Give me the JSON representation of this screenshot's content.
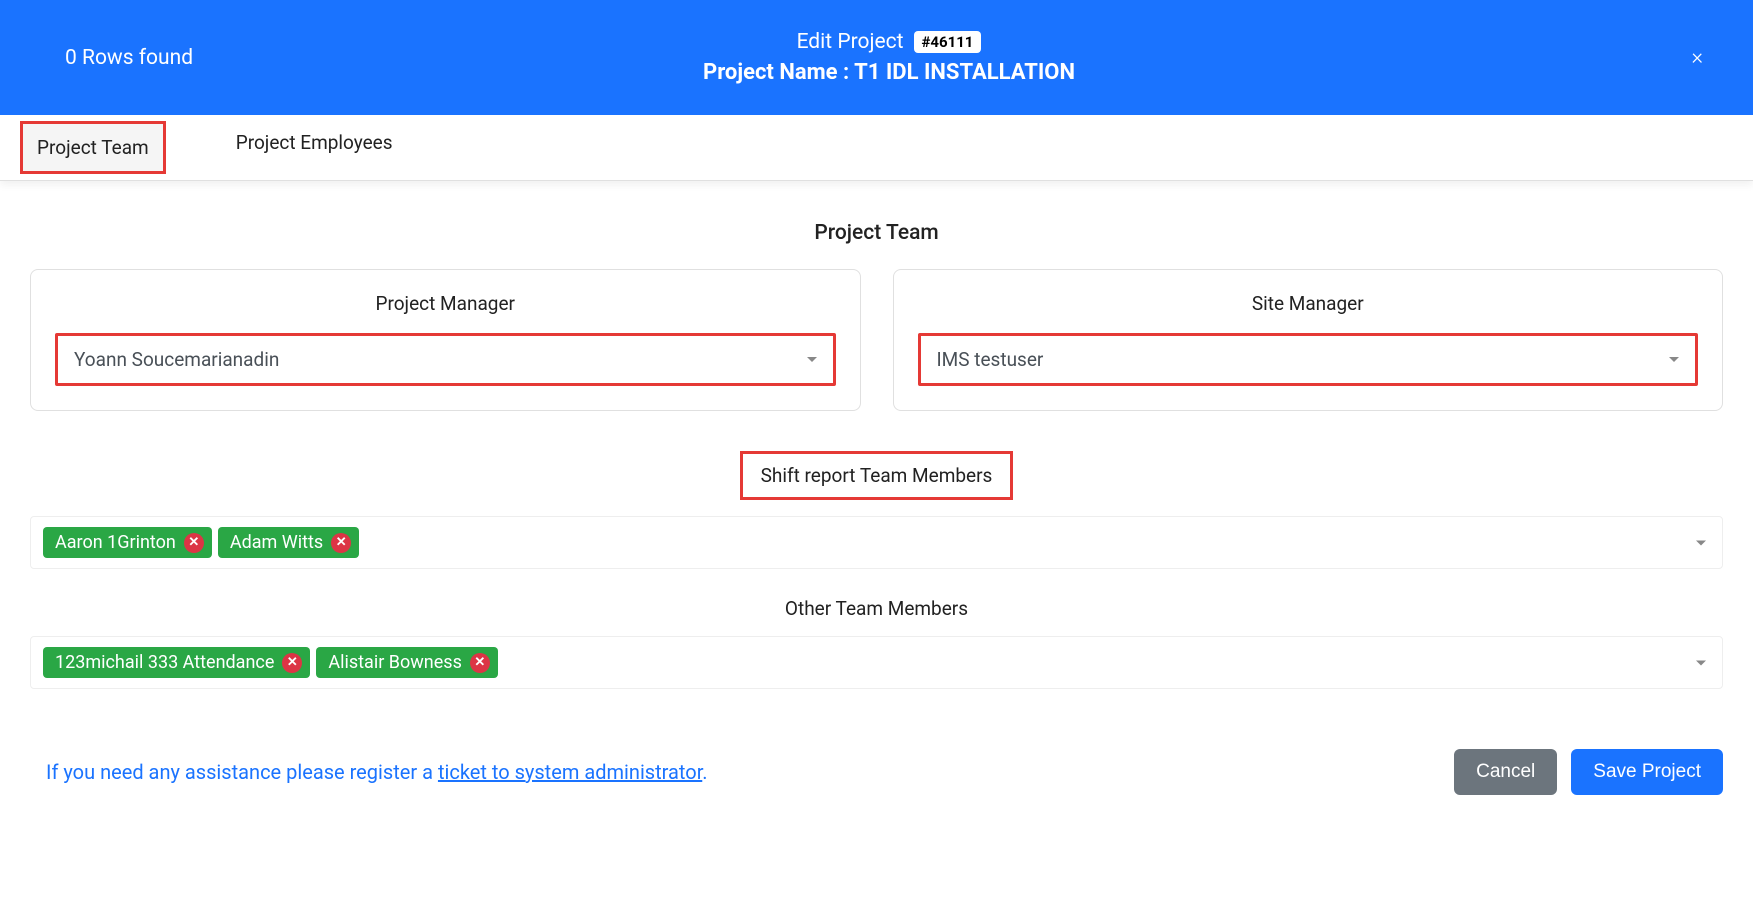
{
  "header": {
    "rows_found": "0 Rows found",
    "title": "Edit Project",
    "project_id": "#46111",
    "subtitle_label": "Project Name :",
    "project_name": "T1 IDL INSTALLATION",
    "close": "×"
  },
  "tabs": {
    "project_team": "Project Team",
    "project_employees": "Project Employees"
  },
  "sections": {
    "project_team_title": "Project Team",
    "project_manager_label": "Project Manager",
    "project_manager_value": "Yoann Soucemarianadin",
    "site_manager_label": "Site Manager",
    "site_manager_value": "IMS testuser",
    "shift_report_label": "Shift report Team Members",
    "shift_tags": [
      "Aaron 1Grinton",
      "Adam Witts"
    ],
    "other_members_label": "Other Team Members",
    "other_tags": [
      "123michail 333 Attendance",
      "Alistair Bowness"
    ]
  },
  "footer": {
    "help_prefix": "If you need any assistance please register a ",
    "help_link": "ticket to system administrator",
    "help_suffix": ".",
    "cancel": "Cancel",
    "save": "Save Project"
  }
}
